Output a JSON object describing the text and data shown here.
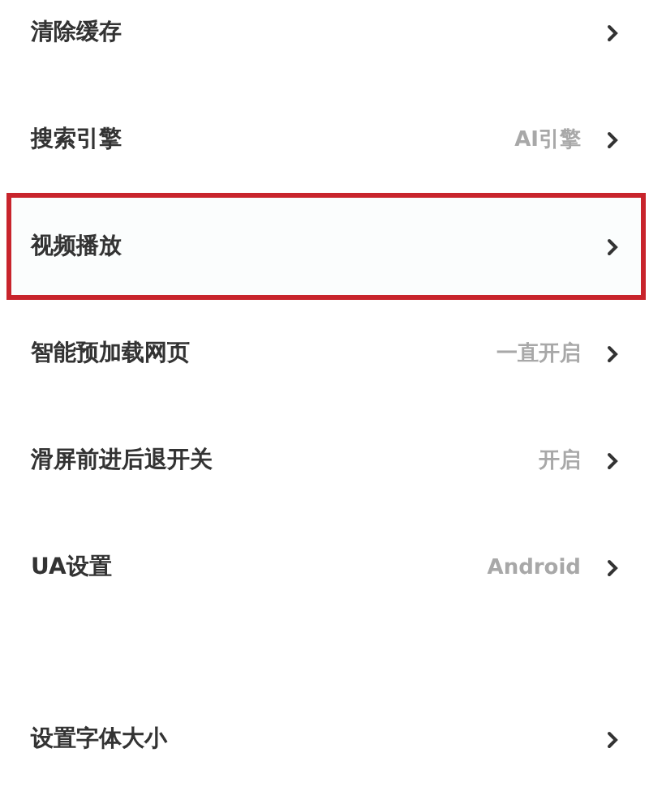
{
  "groups": [
    {
      "items": [
        {
          "label": "清除缓存",
          "highlighted": false
        },
        {
          "label": "搜索引擎",
          "value": "AI引擎",
          "highlighted": false
        },
        {
          "label": "视频播放",
          "highlighted": true
        },
        {
          "label": "智能预加载网页",
          "value": "一直开启",
          "highlighted": false
        },
        {
          "label": "滑屏前进后退开关",
          "value": "开启",
          "highlighted": false
        },
        {
          "label": "UA设置",
          "value": "Android",
          "highlighted": false
        }
      ]
    },
    {
      "items": [
        {
          "label": "设置字体大小",
          "highlighted": false
        }
      ]
    }
  ]
}
